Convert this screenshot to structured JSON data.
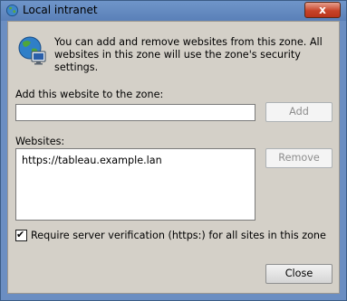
{
  "window": {
    "title": "Local intranet",
    "close_glyph": "x"
  },
  "intro_text": "You can add and remove websites from this zone. All websites in this zone will use the zone's security settings.",
  "add_section": {
    "label": "Add this website to the zone:",
    "input_value": "",
    "add_button_label": "Add"
  },
  "websites_section": {
    "label": "Websites:",
    "items": [
      "https://tableau.example.lan"
    ],
    "remove_button_label": "Remove"
  },
  "require_verification": {
    "label": "Require server verification (https:) for all sites in this zone",
    "checked": true,
    "check_glyph": "✔"
  },
  "close_button_label": "Close",
  "icons": {
    "title": "globe-icon",
    "header": "globe-monitor-icon"
  },
  "colors": {
    "titlebar": "#6f95c9",
    "close_button": "#c8442a",
    "dialog_background": "#d4d0c8",
    "disabled_text": "#8d8d8d"
  }
}
